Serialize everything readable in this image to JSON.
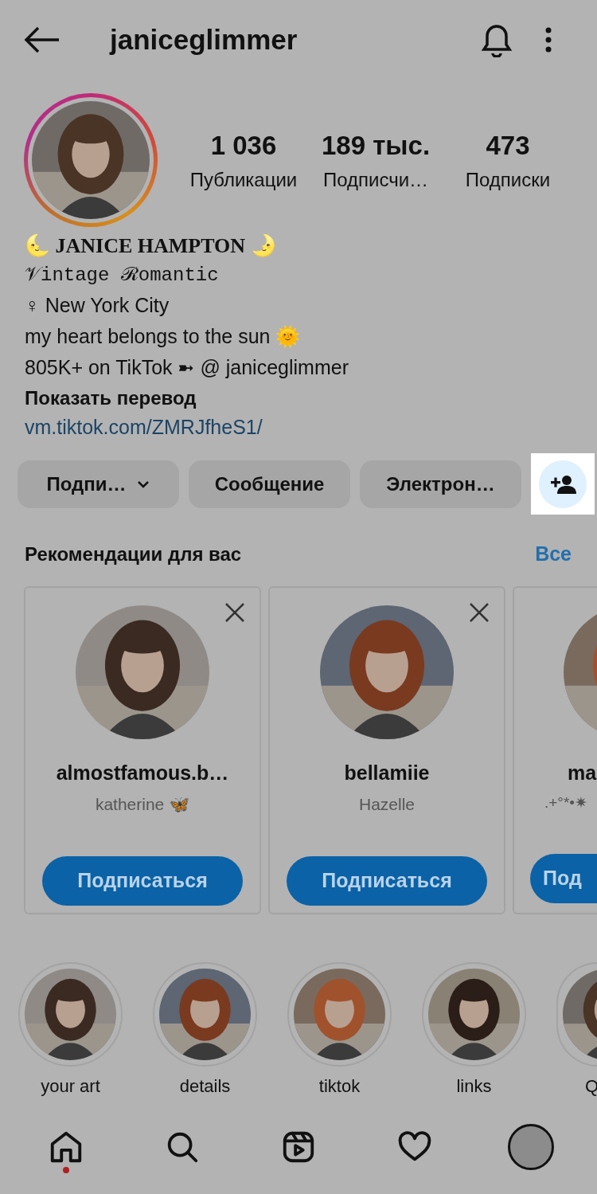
{
  "header": {
    "title": "janiceglimmer"
  },
  "stats": [
    {
      "value": "1 036",
      "label": "Публикации"
    },
    {
      "value": "189 тыс.",
      "label": "Подписчи…"
    },
    {
      "value": "473",
      "label": "Подписки"
    }
  ],
  "bio": {
    "name": "🌜 JANICE HAMPTON 🌛",
    "tagline": "𝒱intage ℛomantic",
    "lines": [
      "♀ New York City",
      "my heart belongs to the sun 🌞",
      "805K+ on TikTok ➼ @ janiceglimmer"
    ],
    "translate": "Показать перевод",
    "link": "vm.tiktok.com/ZMRJfheS1/"
  },
  "actions": [
    {
      "kind": "dropdown",
      "label": "Подпи…"
    },
    {
      "kind": "plain",
      "label": "Сообщение"
    },
    {
      "kind": "plain",
      "label": "Электрон…"
    },
    {
      "kind": "add_person",
      "highlighted": true
    }
  ],
  "recommendations": {
    "title": "Рекомендации для вас",
    "see_all": "Все",
    "cards": [
      {
        "username": "almostfamous.b…",
        "name": "katherine 🦋",
        "button": "Подписаться"
      },
      {
        "username": "bellamiie",
        "name": "Hazelle",
        "button": "Подписаться"
      },
      {
        "username": "ma",
        "name": ".+°*•✷",
        "button": "Под"
      }
    ]
  },
  "highlights": [
    {
      "label": "your art"
    },
    {
      "label": "details"
    },
    {
      "label": "tiktok"
    },
    {
      "label": "links"
    },
    {
      "label": "Q"
    }
  ],
  "nav": [
    {
      "kind": "home",
      "notification": true
    },
    {
      "kind": "search",
      "notification": false
    },
    {
      "kind": "reels",
      "notification": false
    },
    {
      "kind": "heart",
      "notification": false
    },
    {
      "kind": "profile",
      "notification": false
    }
  ]
}
